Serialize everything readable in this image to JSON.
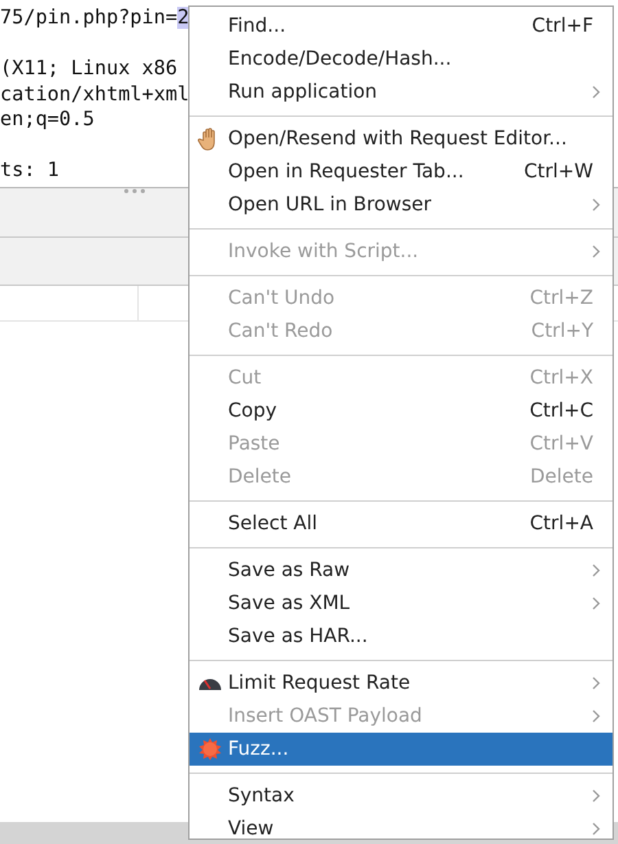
{
  "editor": {
    "lines": [
      {
        "parts": [
          {
            "text": "75/pin.php?pin=",
            "highlighted": false
          },
          {
            "text": "2",
            "highlighted": true
          }
        ]
      },
      {
        "blank": true
      },
      {
        "parts": [
          {
            "text": "(X11; Linux x86",
            "highlighted": false
          }
        ]
      },
      {
        "parts": [
          {
            "text": "cation/xhtml+xml",
            "highlighted": false
          }
        ]
      },
      {
        "parts": [
          {
            "text": "en;q=0.5",
            "highlighted": false
          }
        ]
      },
      {
        "blank": true
      },
      {
        "parts": [
          {
            "text": "ts: 1",
            "highlighted": false
          }
        ]
      }
    ]
  },
  "context_menu": {
    "items": [
      {
        "kind": "item",
        "label": "Find...",
        "shortcut": "Ctrl+F",
        "disabled": false,
        "selected": false
      },
      {
        "kind": "item",
        "label": "Encode/Decode/Hash...",
        "disabled": false,
        "selected": false
      },
      {
        "kind": "item",
        "label": "Run application",
        "submenu": true,
        "disabled": false,
        "selected": false
      },
      {
        "kind": "separator"
      },
      {
        "kind": "item",
        "label": "Open/Resend with Request Editor...",
        "disabled": false,
        "selected": false
      },
      {
        "kind": "item",
        "label": "Open in Requester Tab...",
        "shortcut": "Ctrl+W",
        "disabled": false,
        "selected": false
      },
      {
        "kind": "item",
        "label": "Open URL in Browser",
        "submenu": true,
        "disabled": false,
        "selected": false
      },
      {
        "kind": "separator"
      },
      {
        "kind": "item",
        "label": "Invoke with Script...",
        "submenu": true,
        "disabled": true,
        "selected": false
      },
      {
        "kind": "separator"
      },
      {
        "kind": "item",
        "label": "Can't Undo",
        "shortcut": "Ctrl+Z",
        "disabled": true,
        "selected": false
      },
      {
        "kind": "item",
        "label": "Can't Redo",
        "shortcut": "Ctrl+Y",
        "disabled": true,
        "selected": false
      },
      {
        "kind": "separator"
      },
      {
        "kind": "item",
        "label": "Cut",
        "shortcut": "Ctrl+X",
        "disabled": true,
        "selected": false
      },
      {
        "kind": "item",
        "label": "Copy",
        "shortcut": "Ctrl+C",
        "disabled": false,
        "selected": false
      },
      {
        "kind": "item",
        "label": "Paste",
        "shortcut": "Ctrl+V",
        "disabled": true,
        "selected": false
      },
      {
        "kind": "item",
        "label": "Delete",
        "shortcut": "Delete",
        "disabled": true,
        "selected": false
      },
      {
        "kind": "separator"
      },
      {
        "kind": "item",
        "label": "Select All",
        "shortcut": "Ctrl+A",
        "disabled": false,
        "selected": false
      },
      {
        "kind": "separator"
      },
      {
        "kind": "item",
        "label": "Save as Raw",
        "submenu": true,
        "disabled": false,
        "selected": false
      },
      {
        "kind": "item",
        "label": "Save as XML",
        "submenu": true,
        "disabled": false,
        "selected": false
      },
      {
        "kind": "item",
        "label": "Save as HAR...",
        "disabled": false,
        "selected": false
      },
      {
        "kind": "separator"
      },
      {
        "kind": "item",
        "label": "Limit Request Rate",
        "submenu": true,
        "disabled": false,
        "selected": false
      },
      {
        "kind": "item",
        "label": "Insert OAST Payload",
        "submenu": true,
        "disabled": true,
        "selected": false
      },
      {
        "kind": "item",
        "label": "Fuzz...",
        "disabled": false,
        "selected": true
      },
      {
        "kind": "separator"
      },
      {
        "kind": "item",
        "label": "Syntax",
        "submenu": true,
        "disabled": false,
        "selected": false
      },
      {
        "kind": "item",
        "label": "View",
        "submenu": true,
        "disabled": false,
        "selected": false
      }
    ]
  }
}
